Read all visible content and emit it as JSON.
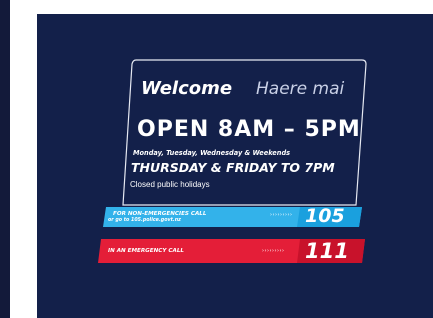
{
  "sign": {
    "welcome_english": "Welcome",
    "welcome_maori": "Haere mai",
    "open_hours": "OPEN 8AM – 5PM",
    "days": "Monday, Tuesday, Wednesday & Weekends",
    "late_days": "THURSDAY & FRIDAY TO 7PM",
    "closed_note": "Closed public holidays"
  },
  "non_emergency": {
    "label": "FOR NON-EMERGENCIES CALL",
    "sub": "or go to 105.police.govt.nz",
    "number": "105",
    "color": "#33b2ea"
  },
  "emergency": {
    "label": "IN AN EMERGENCY CALL",
    "number": "111",
    "color": "#e41e38"
  },
  "colors": {
    "panel": "#13204a",
    "text": "#ffffff",
    "maori_text": "#c9d0e6"
  }
}
